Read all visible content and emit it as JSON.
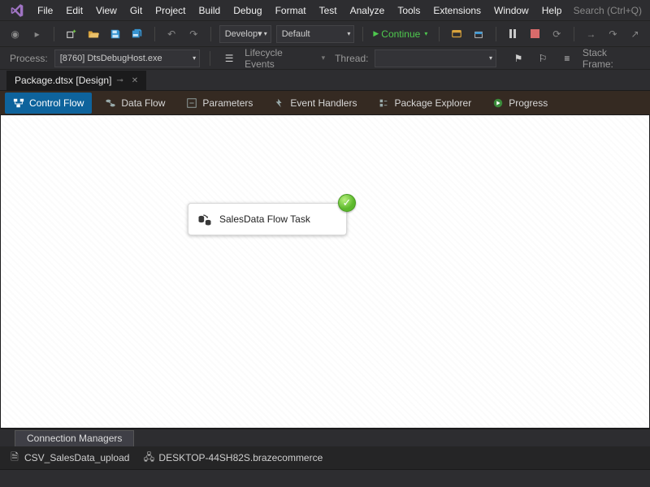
{
  "menu": {
    "items": [
      "File",
      "Edit",
      "View",
      "Git",
      "Project",
      "Build",
      "Debug",
      "Format",
      "Test",
      "Analyze",
      "Tools",
      "Extensions",
      "Window",
      "Help"
    ],
    "search_placeholder": "Search (Ctrl+Q)"
  },
  "toolbar": {
    "config_dropdown": "Develop▾",
    "platform_dropdown": "Default",
    "continue_label": "Continue"
  },
  "process_bar": {
    "process_label": "Process:",
    "process_value": "[8760] DtsDebugHost.exe",
    "lifecycle_label": "Lifecycle Events",
    "thread_label": "Thread:",
    "stackframe_label": "Stack Frame:"
  },
  "doc_tab": {
    "title": "Package.dtsx [Design]"
  },
  "designer_tabs": {
    "control_flow": "Control Flow",
    "data_flow": "Data Flow",
    "parameters": "Parameters",
    "event_handlers": "Event Handlers",
    "package_explorer": "Package Explorer",
    "progress": "Progress"
  },
  "task_node": {
    "label": "SalesData Flow Task"
  },
  "connection_managers": {
    "header": "Connection Managers",
    "items": [
      "CSV_SalesData_upload",
      "DESKTOP-44SH82S.brazecommerce"
    ]
  }
}
